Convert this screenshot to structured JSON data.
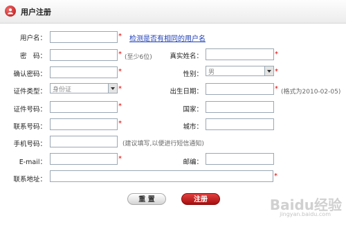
{
  "header": {
    "title": "用户注册"
  },
  "form": {
    "username": {
      "label": "用户名：",
      "value": "",
      "required": "*",
      "link": "检测是否有相同的用户名"
    },
    "password": {
      "label": "密　码：",
      "value": "",
      "required": "*",
      "hint": "(至少6位)"
    },
    "confirm_password": {
      "label": "确认密码：",
      "value": "",
      "required": "*"
    },
    "id_type": {
      "label": "证件类型：",
      "selected": "身份证",
      "required": "*"
    },
    "id_number": {
      "label": "证件号码：",
      "value": "",
      "required": "*"
    },
    "phone": {
      "label": "联系号码：",
      "value": "",
      "required": "*"
    },
    "mobile": {
      "label": "手机号码：",
      "value": "",
      "hint": "(建议填写,以便进行短信通知)"
    },
    "email": {
      "label": "E-mail：",
      "value": "",
      "required": "*"
    },
    "address": {
      "label": "联系地址：",
      "value": "",
      "required": "*"
    },
    "real_name": {
      "label": "真实姓名：",
      "value": "",
      "required": "*"
    },
    "gender": {
      "label": "性别：",
      "selected": "男",
      "required": "*"
    },
    "birthdate": {
      "label": "出生日期：",
      "value": "",
      "required": "*",
      "hint": "(格式为2010-02-05)"
    },
    "country": {
      "label": "国家：",
      "value": ""
    },
    "city": {
      "label": "城市：",
      "value": ""
    },
    "zip": {
      "label": "邮编：",
      "value": ""
    }
  },
  "buttons": {
    "reset": "重 置",
    "submit": "注册"
  },
  "watermark": {
    "text": "Baidu经验",
    "sub": "jingyan.baidu.com"
  },
  "colors": {
    "required": "#dd0000",
    "link": "#1f3fb5",
    "submit": "#c01515"
  }
}
